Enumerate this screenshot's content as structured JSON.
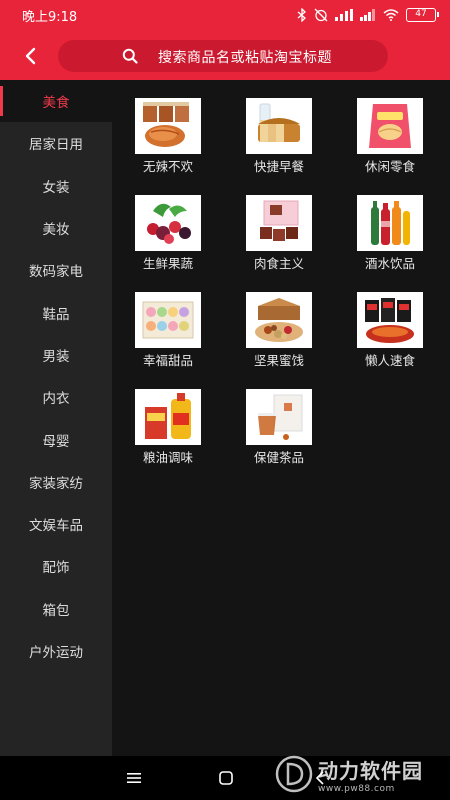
{
  "status_bar": {
    "time": "晚上9:18",
    "battery": "47"
  },
  "search": {
    "placeholder": "搜索商品名或粘贴淘宝标题"
  },
  "sidebar": {
    "items": [
      {
        "label": "美食",
        "active": true
      },
      {
        "label": "居家日用"
      },
      {
        "label": "女装"
      },
      {
        "label": "美妆"
      },
      {
        "label": "数码家电"
      },
      {
        "label": "鞋品"
      },
      {
        "label": "男装"
      },
      {
        "label": "内衣"
      },
      {
        "label": "母婴"
      },
      {
        "label": "家装家纺"
      },
      {
        "label": "文娱车品"
      },
      {
        "label": "配饰"
      },
      {
        "label": "箱包"
      },
      {
        "label": "户外运动"
      }
    ]
  },
  "categories": [
    {
      "label": "无辣不欢",
      "icon": "spicy-snack-icon"
    },
    {
      "label": "快捷早餐",
      "icon": "bread-breakfast-icon"
    },
    {
      "label": "休闲零食",
      "icon": "chips-snack-icon"
    },
    {
      "label": "生鲜果蔬",
      "icon": "fresh-fruit-icon"
    },
    {
      "label": "肉食主义",
      "icon": "meat-icon"
    },
    {
      "label": "酒水饮品",
      "icon": "drinks-icon"
    },
    {
      "label": "幸福甜品",
      "icon": "macaron-dessert-icon"
    },
    {
      "label": "坚果蜜饯",
      "icon": "nuts-gift-box-icon"
    },
    {
      "label": "懒人速食",
      "icon": "instant-noodle-icon"
    },
    {
      "label": "粮油调味",
      "icon": "cooking-oil-icon"
    },
    {
      "label": "保健茶品",
      "icon": "tea-icon"
    }
  ],
  "watermark": {
    "title": "动力软件园",
    "url": "www.pw88.com"
  },
  "colors": {
    "brand": "#e8243a",
    "active": "#f03a4a",
    "sidebar_bg": "#242424",
    "content_bg": "#141414"
  }
}
